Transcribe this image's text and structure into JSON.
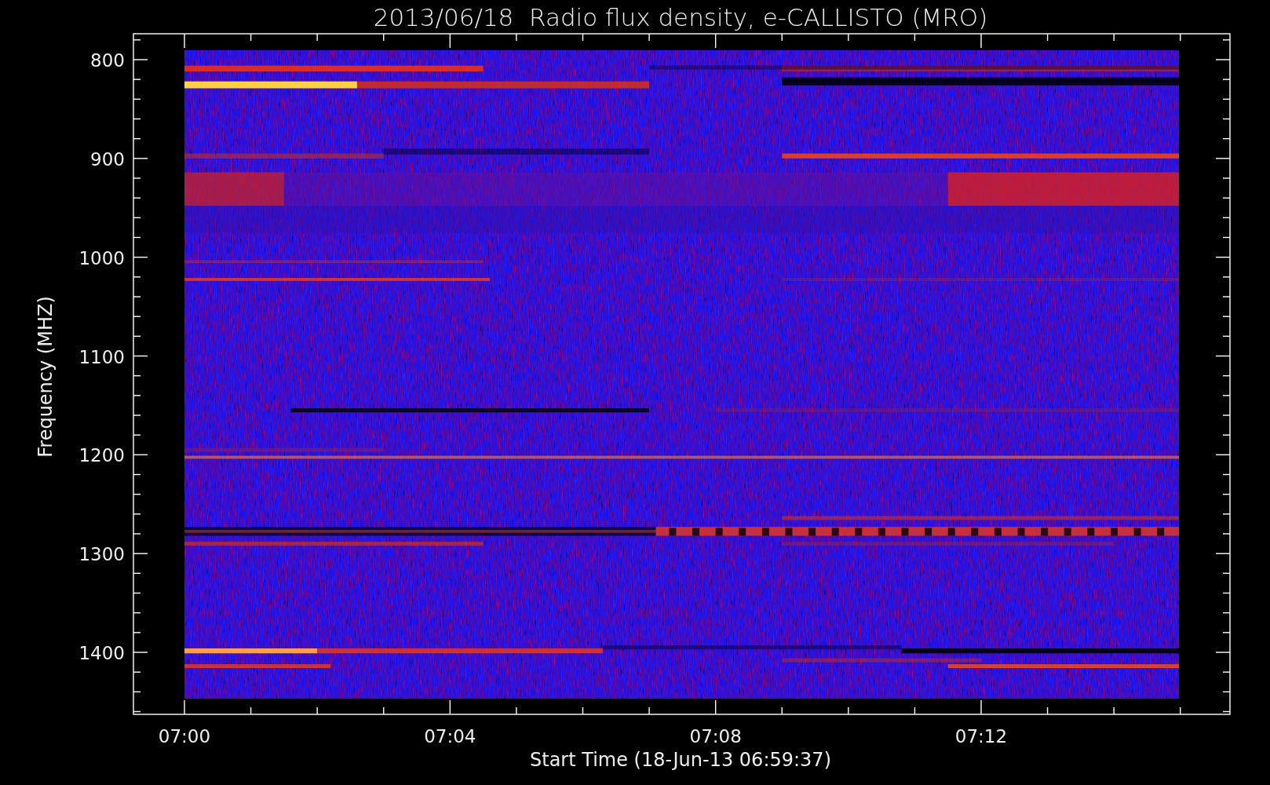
{
  "title": "2013/06/18  Radio flux density, e-CALLISTO (MRO)",
  "y_axis": {
    "label": "Frequency (MHZ)",
    "ticks": [
      "800",
      "900",
      "1000",
      "1100",
      "1200",
      "1300",
      "1400"
    ]
  },
  "x_axis": {
    "label": "Start Time (18-Jun-13 06:59:37)",
    "ticks": [
      "07:00",
      "07:04",
      "07:08",
      "07:12"
    ]
  }
}
